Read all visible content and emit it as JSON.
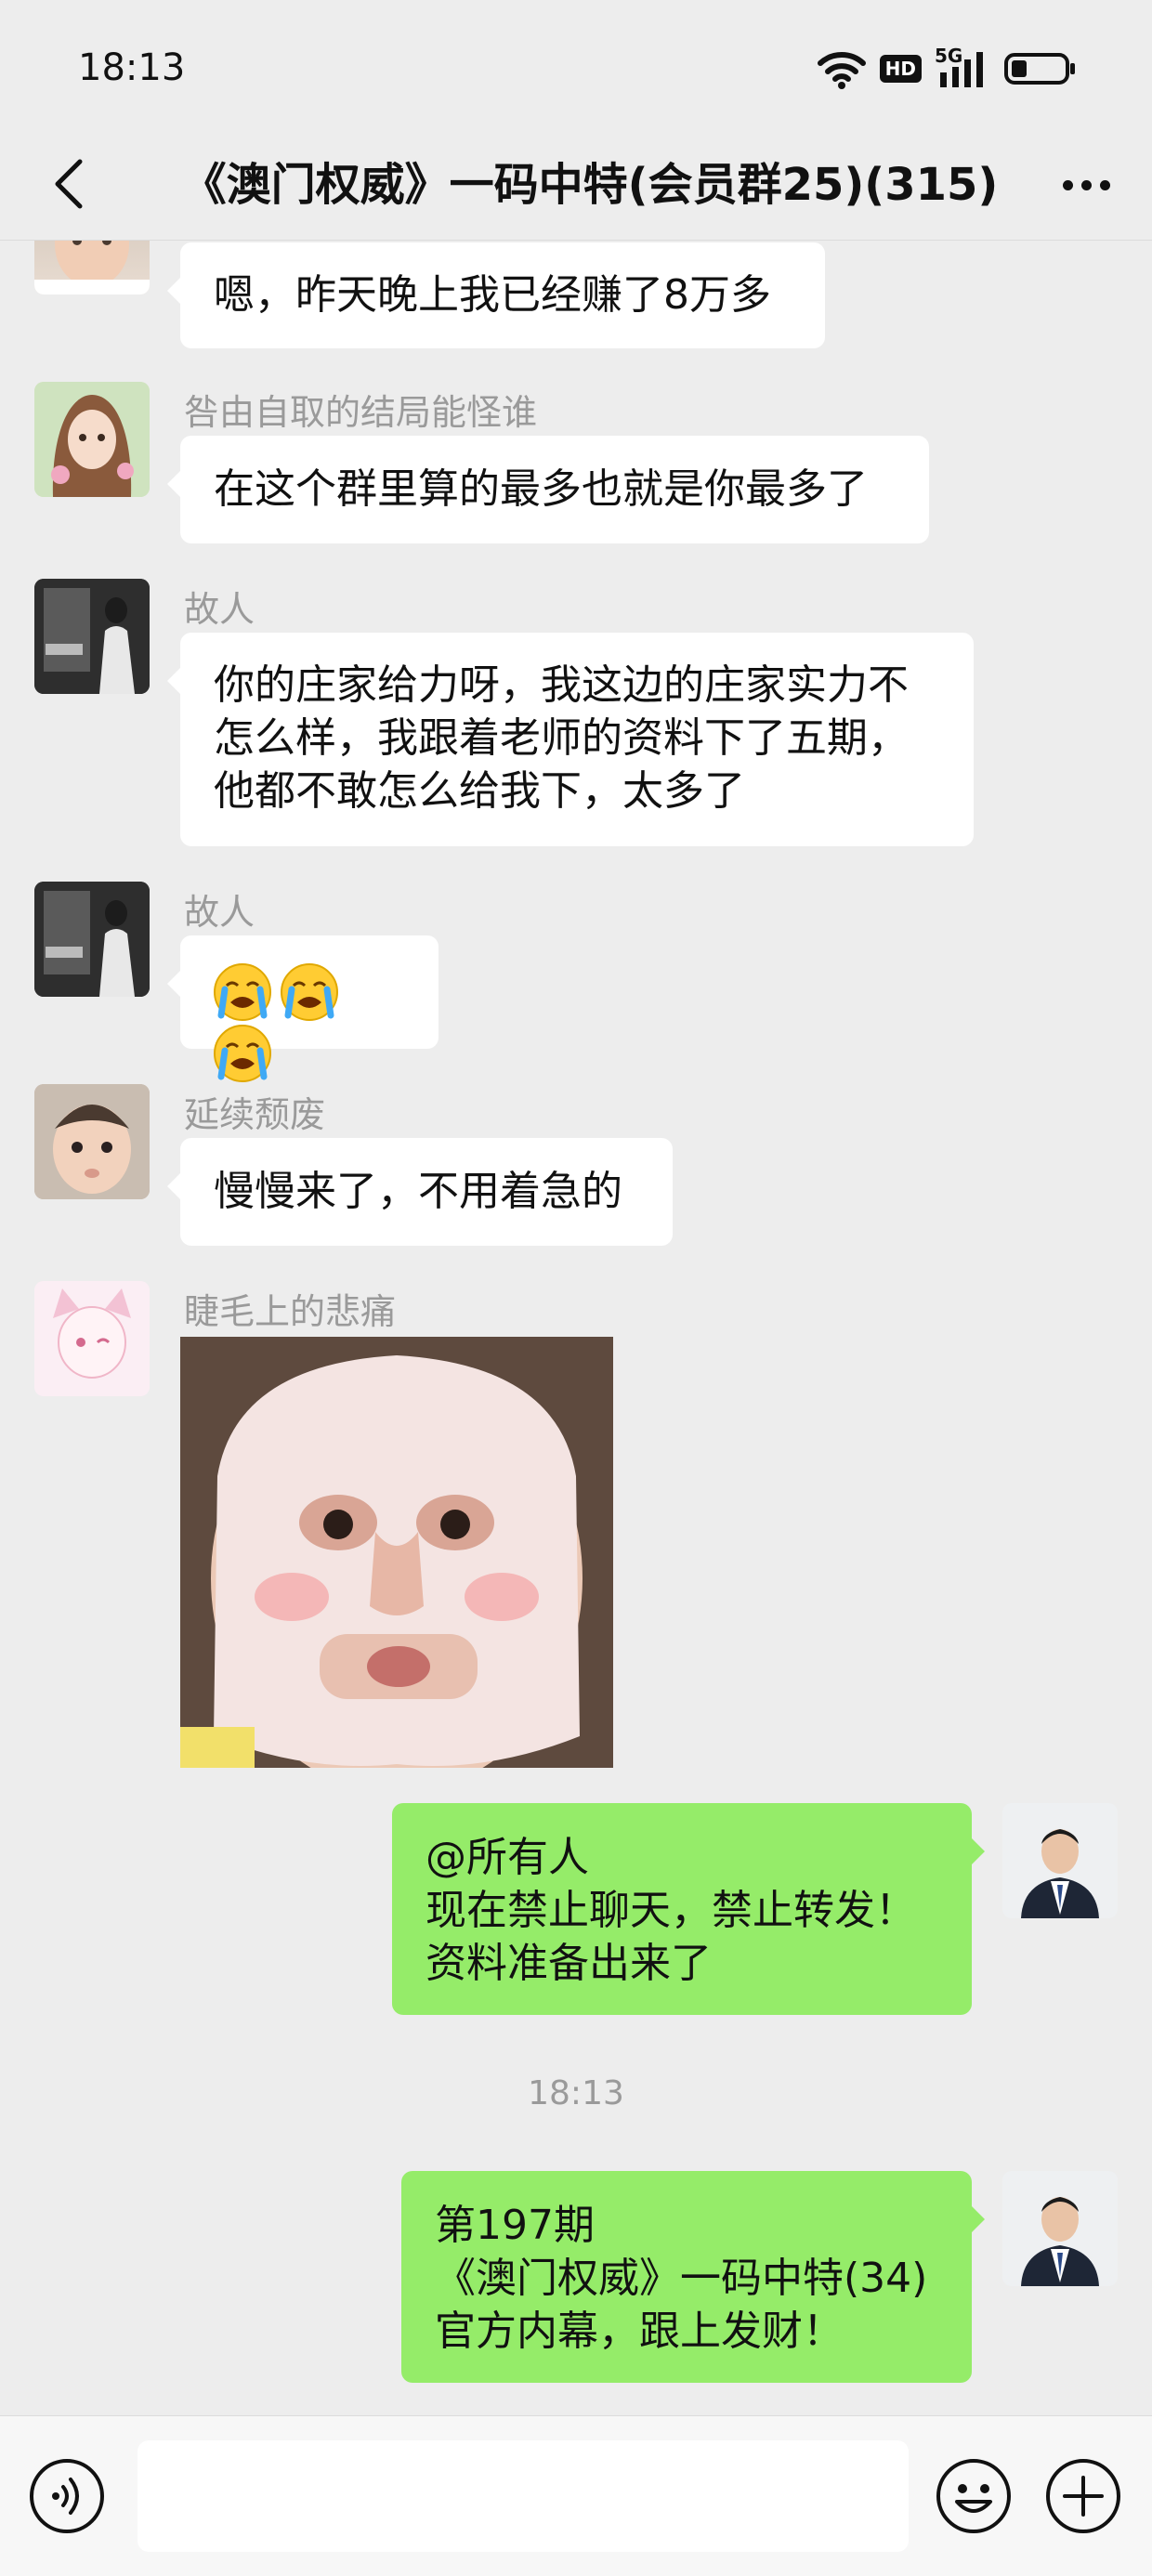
{
  "status_bar": {
    "time": "18:13",
    "hd_label": "HD",
    "network_label": "5G"
  },
  "header": {
    "title": "《澳门权威》一码中特(会员群25)(315)"
  },
  "messages": [
    {
      "sender": "",
      "lines": [
        "嗯，昨天晚上我已经赚了8万多"
      ]
    },
    {
      "sender": "咎由自取的结局能怪谁",
      "lines": [
        "在这个群里算的最多也就是你最多了"
      ]
    },
    {
      "sender": "故人",
      "lines": [
        "你的庄家给力呀，我这边的庄家实力不",
        "怎么样，我跟着老师的资料下了五期，",
        "他都不敢怎么给我下，太多了"
      ]
    },
    {
      "sender": "故人",
      "lines": [],
      "emoji": [
        "loudly-crying-face",
        "loudly-crying-face",
        "loudly-crying-face"
      ]
    },
    {
      "sender": "延续颓废",
      "lines": [
        "慢慢来了，不用着急的"
      ]
    },
    {
      "sender": "睫毛上的悲痛",
      "image": "baby-face-mask-sticker"
    },
    {
      "sender": "self",
      "lines": [
        "@所有人",
        "现在禁止聊天，禁止转发！",
        "资料准备出来了"
      ]
    },
    {
      "timestamp": "18:13"
    },
    {
      "sender": "self",
      "lines": [
        "第197期",
        "《澳门权威》一码中特(34)",
        "官方内幕，跟上发财！"
      ]
    }
  ],
  "input_bar": {
    "placeholder": ""
  },
  "colors": {
    "background": "#ededed",
    "bubble_self": "#95ec69",
    "bubble_other": "#ffffff",
    "name_text": "#9a9a9a"
  }
}
